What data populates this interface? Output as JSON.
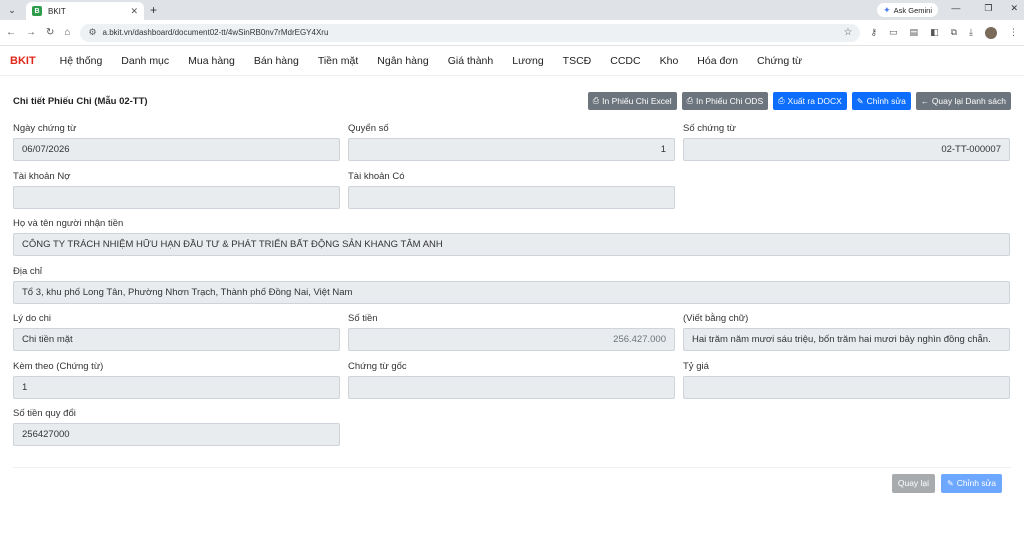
{
  "browser": {
    "tab_title": "BKIT",
    "tab_favicon": "B",
    "url": "a.bkit.vn/dashboard/document02-tt/4wSinRB0nv7rMdrEGY4Xru",
    "ask_gemini": "Ask Gemini"
  },
  "nav": {
    "brand": "BKIT",
    "items": [
      "Hệ thống",
      "Danh mục",
      "Mua hàng",
      "Bán hàng",
      "Tiền mặt",
      "Ngân hàng",
      "Giá thành",
      "Lương",
      "TSCĐ",
      "CCDC",
      "Kho",
      "Hóa đơn",
      "Chứng từ"
    ]
  },
  "page": {
    "title": "Chi tiết Phiếu Chi (Mẫu 02-TT)",
    "buttons": {
      "print_excel": "In Phiếu Chi Excel",
      "print_ods": "In Phiếu Chi ODS",
      "export_docx": "Xuất ra DOCX",
      "edit": "Chỉnh sửa",
      "back_list": "Quay lại Danh sách"
    }
  },
  "form": {
    "ngay_chung_tu": {
      "label": "Ngày chứng từ",
      "value": "06/07/2026"
    },
    "quyen_so": {
      "label": "Quyển số",
      "value": "1"
    },
    "so_chung_tu": {
      "label": "Số chứng từ",
      "value": "02-TT-000007"
    },
    "tk_no": {
      "label": "Tài khoản Nợ",
      "value": ""
    },
    "tk_co": {
      "label": "Tài khoản Có",
      "value": ""
    },
    "nguoi_nhan": {
      "label": "Họ và tên người nhận tiền",
      "value": "CÔNG TY TRÁCH NHIỆM HỮU HẠN ĐẦU TƯ & PHÁT TRIỂN BẤT ĐỘNG SẢN KHANG TÂM ANH"
    },
    "dia_chi": {
      "label": "Địa chỉ",
      "value": "Tổ 3, khu phố Long Tân, Phường Nhơn Trạch, Thành phố Đồng Nai, Việt Nam"
    },
    "ly_do": {
      "label": "Lý do chi",
      "value": "Chi tiền mặt"
    },
    "so_tien": {
      "label": "Số tiền",
      "value": "256.427.000"
    },
    "bang_chu": {
      "label": "(Viết bằng chữ)",
      "value": "Hai trăm năm mươi sáu triệu, bốn trăm hai mươi bảy nghìn đồng chẵn."
    },
    "kem_theo": {
      "label": "Kèm theo (Chứng từ)",
      "value": "1"
    },
    "chung_tu_goc": {
      "label": "Chứng từ gốc",
      "value": ""
    },
    "ty_gia": {
      "label": "Tỷ giá",
      "value": ""
    },
    "quy_doi": {
      "label": "Số tiền quy đổi",
      "value": "256427000"
    }
  },
  "footer": {
    "back": "Quay lại",
    "edit": "Chỉnh sửa"
  }
}
